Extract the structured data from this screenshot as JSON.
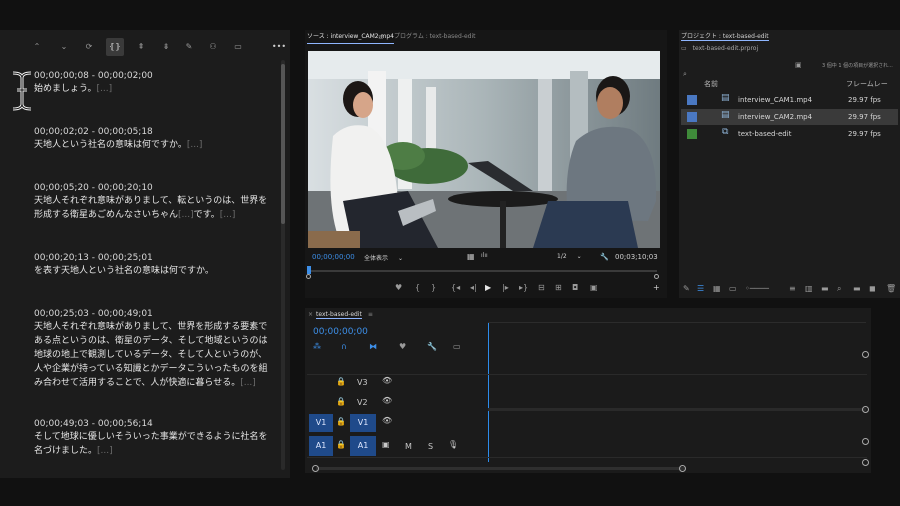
{
  "transcript": {
    "entries": [
      {
        "tc": "00;00;00;08 - 00;00;02;00",
        "text": "始めましょう。",
        "ell": "[...]"
      },
      {
        "tc": "00;00;02;02 - 00;00;05;18",
        "text": "天地人という社名の意味は何ですか。",
        "ell": "[...]"
      },
      {
        "tc": "00;00;05;20 - 00;00;20;10",
        "text1": "天地人それぞれ意味がありまして、転というのは、世界を",
        "text2": "形成する衛星あごめんなさいちゃん",
        "ell": "[...]",
        "text3": "です。",
        "ell2": "[...]"
      },
      {
        "tc": "00;00;20;13 - 00;00;25;01",
        "text": "を表す天地人という社名の意味は何ですか。"
      },
      {
        "tc": "00;00;25;03 - 00;00;49;01",
        "lines": [
          "天地人それぞれ意味がありまして、世界を形成する要素で",
          "ある点というのは、衛星のデータ、そして地域というのは",
          "地球の地上で観測しているデータ、そして人というのが、",
          "人や企業が持っている知識とかデータこういったものを組",
          "み合わせて活用することで、人が快適に暮らせる。"
        ],
        "ell": "[...]"
      },
      {
        "tc": "00;00;49;03 - 00;00;56;14",
        "lines": [
          "そして地球に優しいそういった事業ができるように社名を",
          "名づけました。"
        ],
        "ell": "[...]"
      }
    ]
  },
  "monitor": {
    "source_tab": "ソース : interview_CAM2.mp4",
    "program_tab": "プログラム : text-based-edit",
    "timecode_left": "00;00;00;00",
    "fit": "全体表示",
    "scale": "1/2",
    "timecode_right": "00;03;10;03"
  },
  "project": {
    "title": "プロジェクト : text-based-edit",
    "file": "text-based-edit.prproj",
    "selection_info": "3 個中 1 個の項目が選択され...",
    "col_name": "名前",
    "col_fps": "フレームレー",
    "items": [
      {
        "name": "interview_CAM1.mp4",
        "fps": "29.97 fps",
        "color": "#4a78c2"
      },
      {
        "name": "interview_CAM2.mp4",
        "fps": "29.97 fps",
        "color": "#4a78c2"
      },
      {
        "name": "text-based-edit",
        "fps": "29.97 fps",
        "color": "#3f8a3a"
      }
    ]
  },
  "timeline": {
    "title": "text-based-edit",
    "timecode": "00;00;00;00",
    "tracks": [
      {
        "src": "",
        "name": "V3"
      },
      {
        "src": "",
        "name": "V2"
      },
      {
        "src": "V1",
        "name": "V1"
      },
      {
        "src": "A1",
        "name": "A1",
        "m": "M",
        "s": "S"
      }
    ]
  },
  "colors": {
    "accent": "#2d8ceb",
    "track_blue": "#1f4a8a"
  }
}
